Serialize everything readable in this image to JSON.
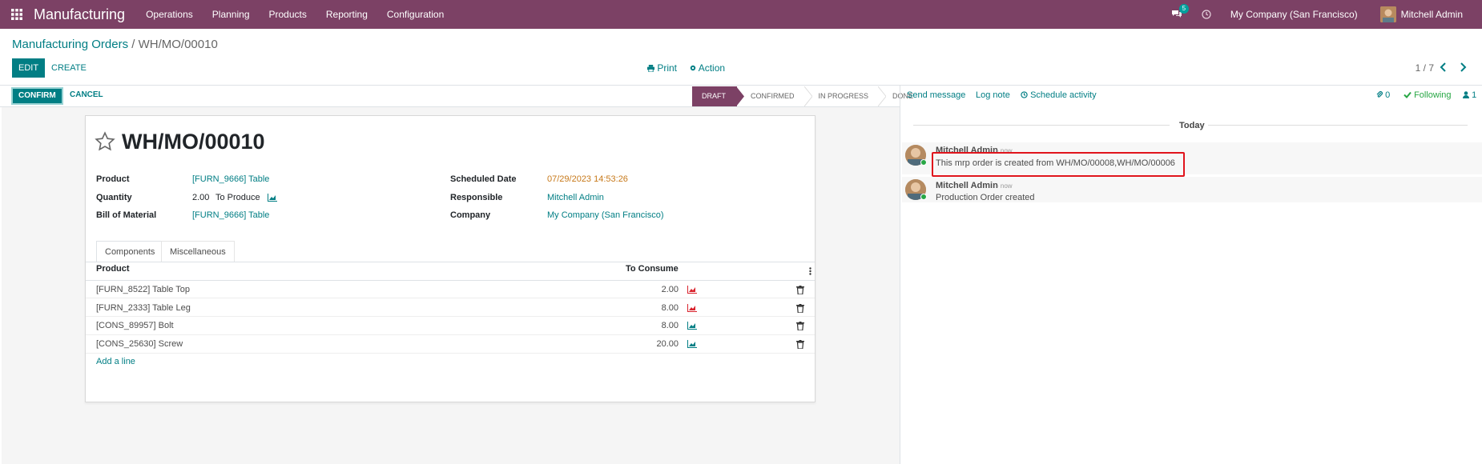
{
  "navbar": {
    "brand": "Manufacturing",
    "menu": [
      "Operations",
      "Planning",
      "Products",
      "Reporting",
      "Configuration"
    ],
    "messages_badge": "5",
    "company": "My Company (San Francisco)",
    "user": "Mitchell Admin",
    "color": "#7c4165"
  },
  "breadcrumb": {
    "parent": "Manufacturing Orders",
    "separator": " / ",
    "current": "WH/MO/00010"
  },
  "control": {
    "edit": "EDIT",
    "create": "CREATE",
    "print": "Print",
    "action": "Action",
    "pager": "1 / 7"
  },
  "statusbar": {
    "confirm": "CONFIRM",
    "cancel": "CANCEL",
    "steps": [
      "DRAFT",
      "CONFIRMED",
      "IN PROGRESS",
      "DONE"
    ],
    "active_step": "DRAFT"
  },
  "form": {
    "title": "WH/MO/00010",
    "left": {
      "product_label": "Product",
      "product_value": "[FURN_9666] Table",
      "quantity_label": "Quantity",
      "quantity_value": "2.00",
      "quantity_unit": "To Produce",
      "bom_label": "Bill of Material",
      "bom_value": "[FURN_9666] Table"
    },
    "right": {
      "scheduled_label": "Scheduled Date",
      "scheduled_value": "07/29/2023 14:53:26",
      "responsible_label": "Responsible",
      "responsible_value": "Mitchell Admin",
      "company_label": "Company",
      "company_value": "My Company (San Francisco)"
    },
    "tabs": [
      "Components",
      "Miscellaneous"
    ],
    "table": {
      "col_product": "Product",
      "col_consume": "To Consume",
      "rows": [
        {
          "product": "[FURN_8522] Table Top",
          "qty": "2.00",
          "status": "unavailable"
        },
        {
          "product": "[FURN_2333] Table Leg",
          "qty": "8.00",
          "status": "unavailable"
        },
        {
          "product": "[CONS_89957] Bolt",
          "qty": "8.00",
          "status": "available"
        },
        {
          "product": "[CONS_25630] Screw",
          "qty": "20.00",
          "status": "available"
        }
      ],
      "add_line": "Add a line"
    }
  },
  "chatter": {
    "send_message": "Send message",
    "log_note": "Log note",
    "schedule_activity": "Schedule activity",
    "attachments": "0",
    "following": "Following",
    "followers": "1",
    "today": "Today",
    "messages": [
      {
        "author": "Mitchell Admin",
        "date": "- now",
        "body": "This mrp order is created from WH/MO/00008,WH/MO/00006"
      },
      {
        "author": "Mitchell Admin",
        "date": "- now",
        "body": "Production Order created"
      }
    ]
  }
}
